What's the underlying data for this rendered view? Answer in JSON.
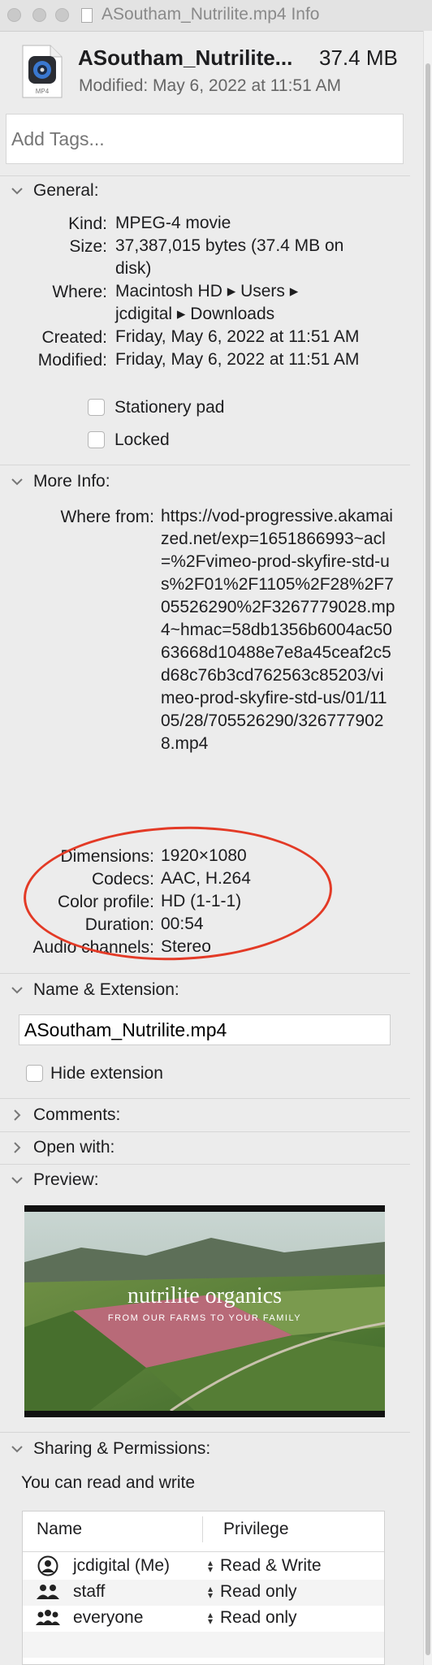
{
  "window": {
    "title": "ASoutham_Nutrilite.mp4 Info"
  },
  "file": {
    "icon_label": "MP4",
    "name": "ASoutham_Nutrilite...",
    "size": "37.4 MB",
    "modified": "Modified: May 6, 2022 at 11:51 AM",
    "tags_placeholder": "Add Tags..."
  },
  "general": {
    "title": "General:",
    "rows": [
      {
        "label": "Kind:",
        "value": "MPEG-4 movie"
      },
      {
        "label": "Size:",
        "value": "37,387,015 bytes (37.4 MB on disk)"
      },
      {
        "label": "Where:",
        "value": "Macintosh HD ▸ Users ▸ jcdigital ▸ Downloads"
      },
      {
        "label": "Created:",
        "value": "Friday, May 6, 2022 at 11:51 AM"
      },
      {
        "label": "Modified:",
        "value": "Friday, May 6, 2022 at 11:51 AM"
      }
    ],
    "stationery_pad": "Stationery pad",
    "locked": "Locked"
  },
  "more_info": {
    "title": "More Info:",
    "where_from_label": "Where from:",
    "where_from_value": "https://vod-progressive.akamaized.net/exp=1651866993~acl=%2Fvimeo-prod-skyfire-std-us%2F01%2F1105%2F28%2F705526290%2F3267779028.mp4~hmac=58db1356b6004ac5063668d10488e7e8a45ceaf2c5d68c76b3cd762563c85203/vimeo-prod-skyfire-std-us/01/1105/28/705526290/3267779028.mp4",
    "rows": [
      {
        "label": "Dimensions:",
        "value": "1920×1080"
      },
      {
        "label": "Codecs:",
        "value": "AAC, H.264"
      },
      {
        "label": "Color profile:",
        "value": "HD (1-1-1)"
      },
      {
        "label": "Duration:",
        "value": "00:54"
      },
      {
        "label": "Audio channels:",
        "value": "Stereo"
      }
    ]
  },
  "name_extension": {
    "title": "Name & Extension:",
    "filename": "ASoutham_Nutrilite.mp4",
    "hide_extension": "Hide extension"
  },
  "comments": {
    "title": "Comments:"
  },
  "open_with": {
    "title": "Open with:"
  },
  "preview": {
    "title": "Preview:",
    "brand": "nutrilite organics",
    "tagline": "FROM OUR FARMS TO YOUR FAMILY"
  },
  "sharing": {
    "title": "Sharing & Permissions:",
    "summary": "You can read and write",
    "col_name": "Name",
    "col_privilege": "Privilege",
    "rows": [
      {
        "name": "jcdigital (Me)",
        "privilege": "Read & Write",
        "icon": "person-icon"
      },
      {
        "name": "staff",
        "privilege": "Read only",
        "icon": "group-icon"
      },
      {
        "name": "everyone",
        "privilege": "Read only",
        "icon": "everyone-icon"
      }
    ]
  }
}
